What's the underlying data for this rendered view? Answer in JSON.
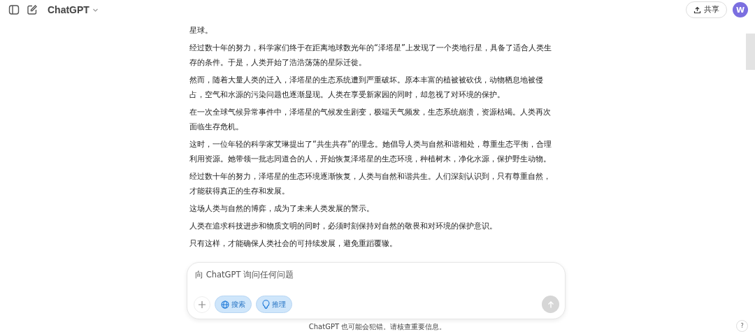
{
  "header": {
    "title": "ChatGPT",
    "share_label": "共享",
    "avatar": "W"
  },
  "messages": [
    "星球。",
    "经过数十年的努力，科学家们终于在距离地球数光年的“泽塔星”上发现了一个类地行星，具备了适合人类生存的条件。于是，人类开始了浩浩荡荡的星际迁徙。",
    "然而，随着大量人类的迁入，泽塔星的生态系统遭到严重破坏。原本丰富的植被被砍伐，动物栖息地被侵占，空气和水源的污染问题也逐渐显现。人类在享受新家园的同时，却忽视了对环境的保护。",
    "在一次全球气候异常事件中，泽塔星的气候发生剧变，极端天气频发，生态系统崩溃，资源枯竭。人类再次面临生存危机。",
    "这时，一位年轻的科学家艾琳提出了“共生共存”的理念。她倡导人类与自然和谐相处，尊重生态平衡，合理利用资源。她带领一批志同道合的人，开始恢复泽塔星的生态环境，种植树木，净化水源，保护野生动物。",
    "经过数十年的努力，泽塔星的生态环境逐渐恢复，人类与自然和谐共生。人们深刻认识到，只有尊重自然，才能获得真正的生存和发展。",
    "这场人类与自然的博弈，成为了未来人类发展的警示。",
    "人类在追求科技进步和物质文明的同时，必须时刻保持对自然的敬畏和对环境的保护意识。",
    "只有这样，才能确保人类社会的可持续发展，避免重蹈覆辙。"
  ],
  "composer": {
    "placeholder": "向 ChatGPT 询问任何问题",
    "tools": [
      {
        "kind": "search",
        "label": "搜索",
        "selected": true
      },
      {
        "kind": "reason",
        "label": "推理",
        "selected": true
      }
    ],
    "send_disabled": true
  },
  "footer": "ChatGPT 也可能会犯错。请核查重要信息。",
  "help": "?"
}
